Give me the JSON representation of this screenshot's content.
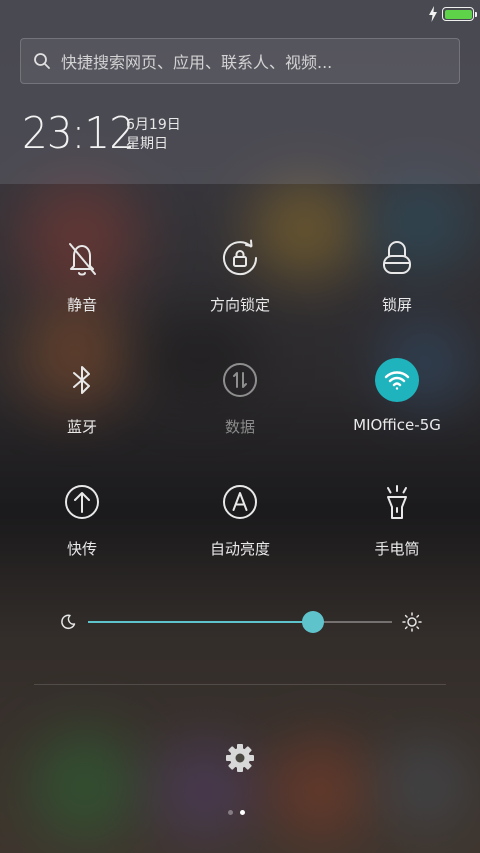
{
  "status_bar": {
    "charging_icon": "lightning-icon",
    "battery_icon": "battery-icon",
    "battery_level": 1.0,
    "battery_color": "#5ed34a"
  },
  "search": {
    "icon": "search-icon",
    "placeholder": "快捷搜索网页、应用、联系人、视频..."
  },
  "clock": {
    "time": "23:12",
    "date": "6月19日",
    "weekday": "星期日"
  },
  "toggles": [
    {
      "label": "静音",
      "icon": "bell-off-icon",
      "active": false
    },
    {
      "label": "方向锁定",
      "icon": "rotation-lock-icon",
      "active": false
    },
    {
      "label": "锁屏",
      "icon": "lock-icon",
      "active": false
    },
    {
      "label": "蓝牙",
      "icon": "bluetooth-icon",
      "active": false
    },
    {
      "label": "数据",
      "icon": "mobile-data-icon",
      "active": false,
      "disabled": true
    },
    {
      "label": "MIOffice-5G",
      "icon": "wifi-icon",
      "active": true
    },
    {
      "label": "快传",
      "icon": "upload-arrow-icon",
      "active": false
    },
    {
      "label": "自动亮度",
      "icon": "auto-brightness-icon",
      "active": false
    },
    {
      "label": "手电筒",
      "icon": "flashlight-icon",
      "active": false
    }
  ],
  "brightness": {
    "level": 0.74,
    "low_icon": "moon-icon",
    "high_icon": "sun-icon",
    "accent_color": "#5fc3cc"
  },
  "footer": {
    "settings_icon": "gear-icon",
    "pages": 2,
    "current_page": 2
  },
  "colors": {
    "wifi_active": "#1fb4bd"
  }
}
